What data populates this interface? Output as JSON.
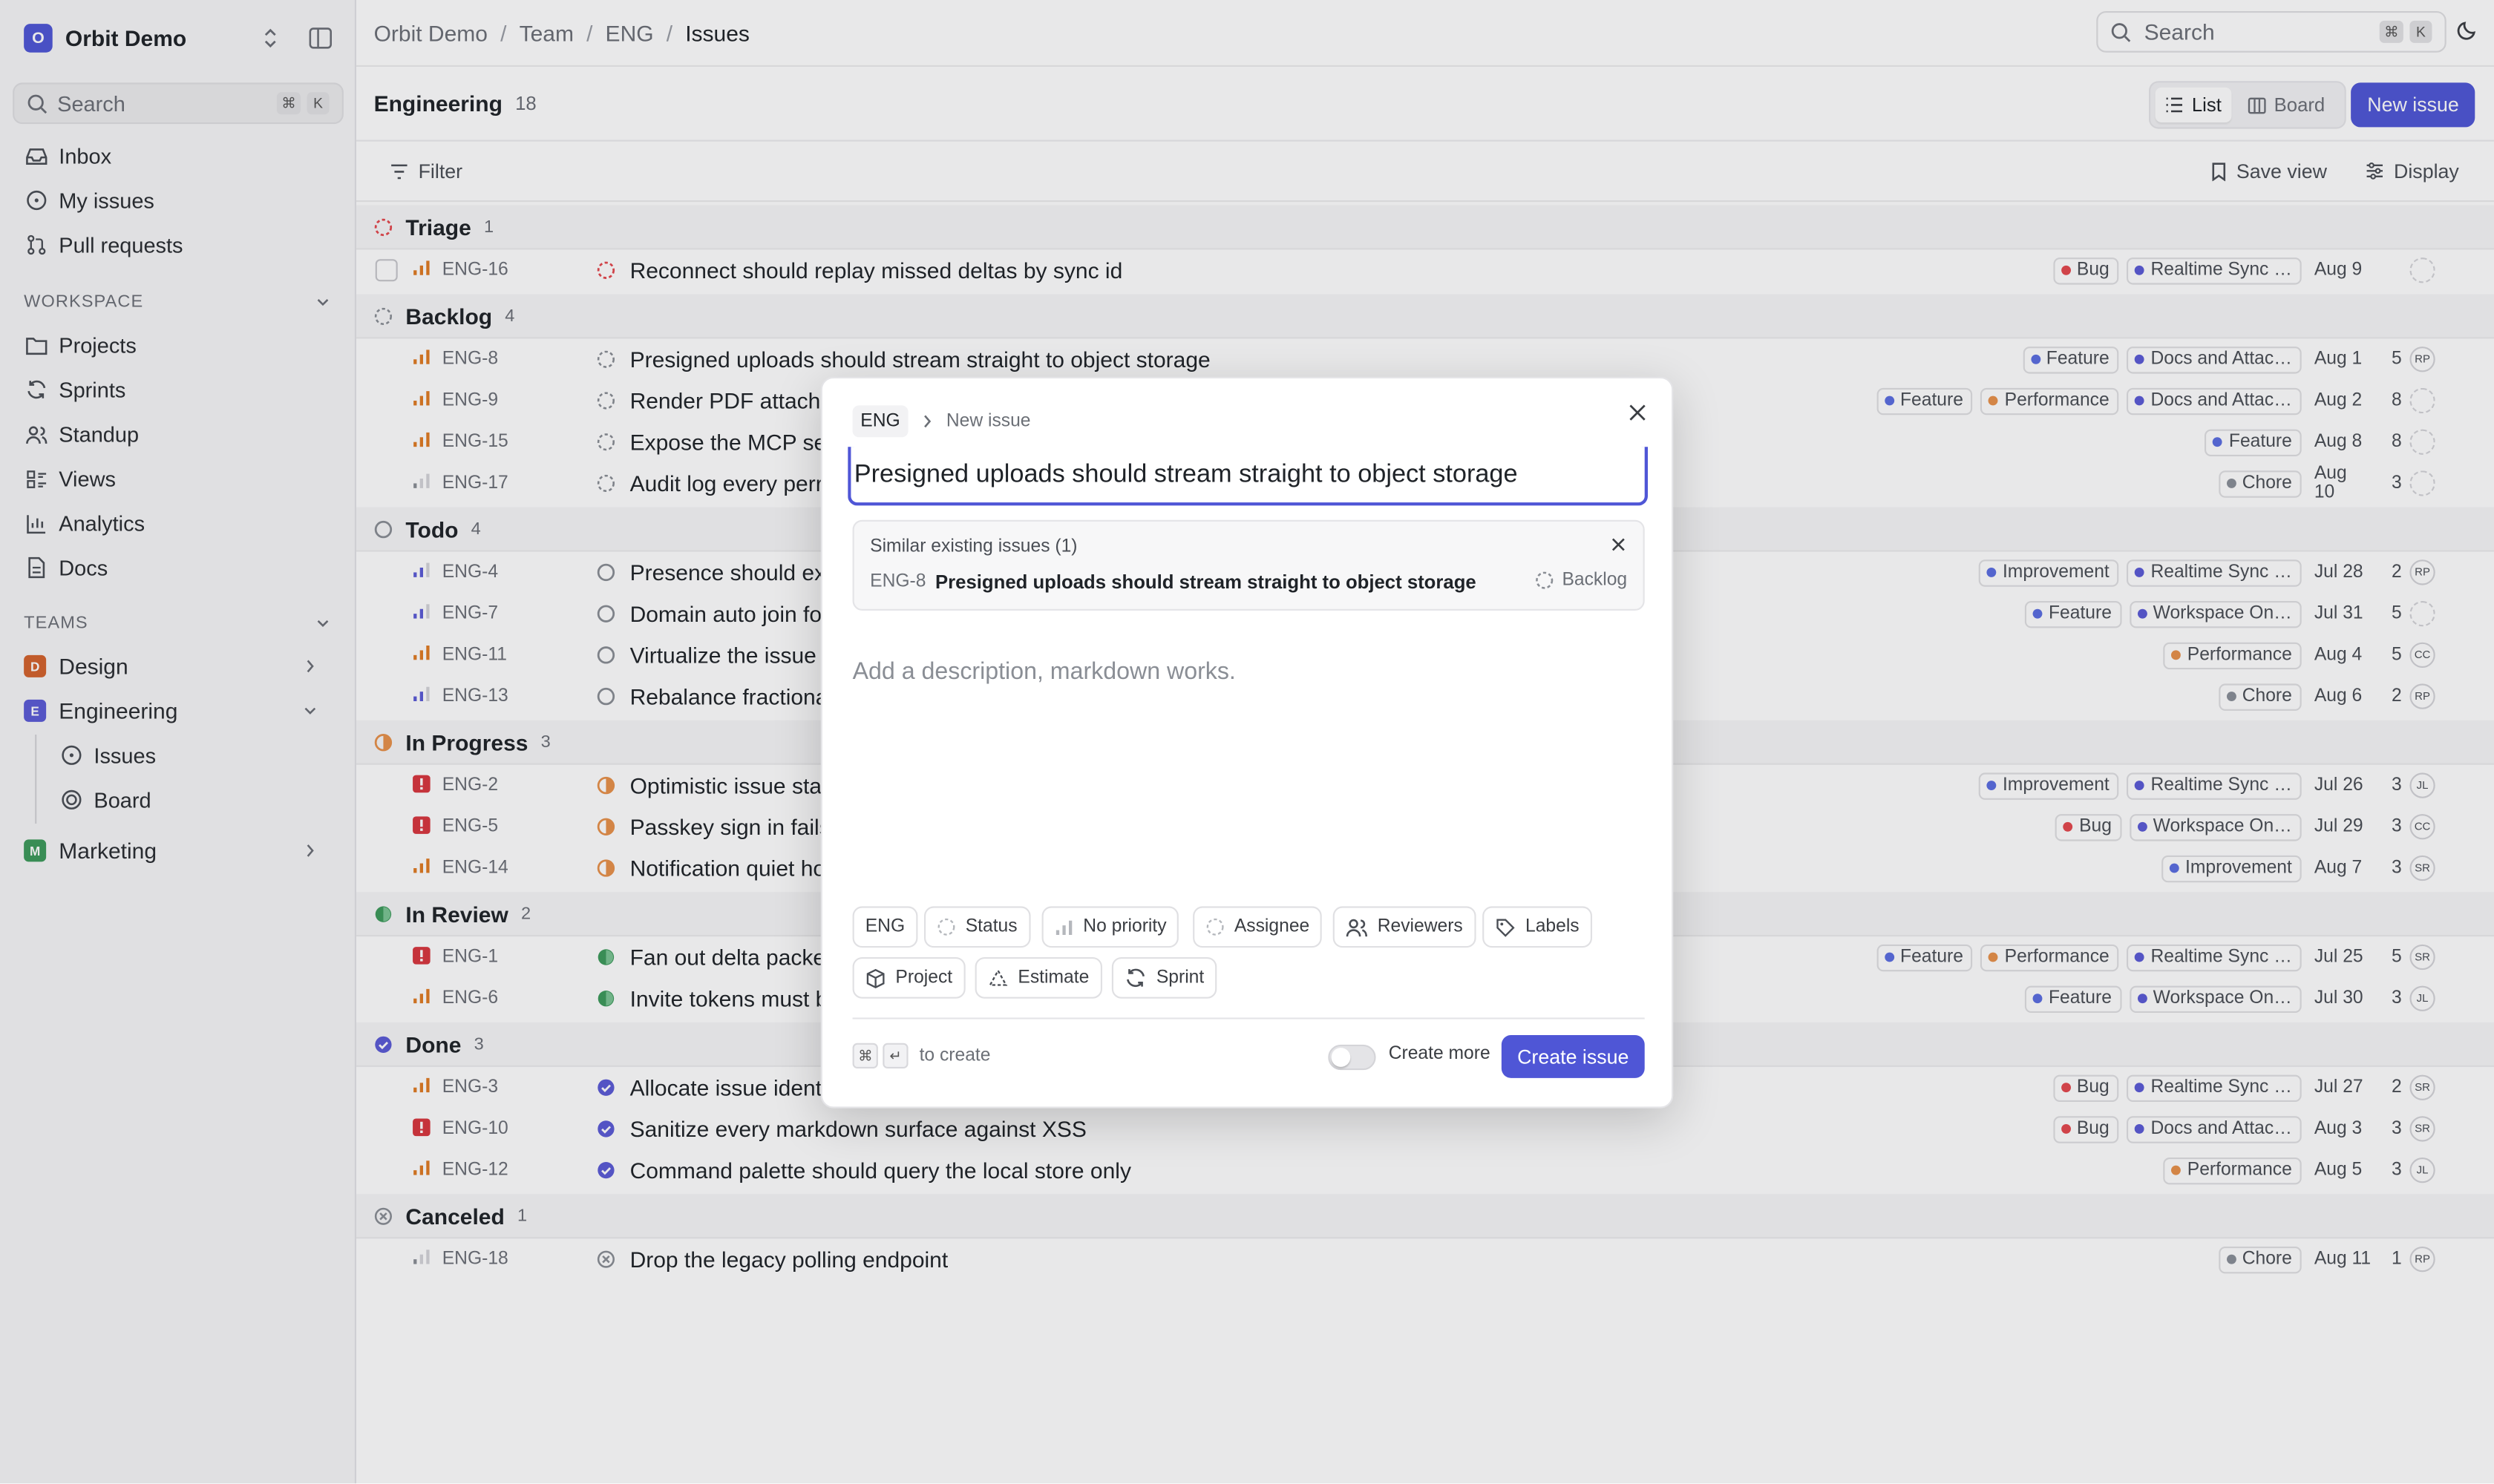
{
  "colors": {
    "accent": "#4f56d6",
    "bug": "#e5484d",
    "feature": "#5b6ee1",
    "performance": "#e8914a",
    "realtime": "#5b5bd6",
    "docs": "#5b5bd6",
    "workspace": "#5b5bd6",
    "improvement": "#5b6ee1",
    "chore": "#8a8f98"
  },
  "sidebar": {
    "workspace_initial": "O",
    "workspace_name": "Orbit Demo",
    "search_placeholder": "Search",
    "search_kbd": [
      "⌘",
      "K"
    ],
    "top_items": [
      {
        "label": "Inbox",
        "icon": "inbox-icon"
      },
      {
        "label": "My issues",
        "icon": "target-icon"
      },
      {
        "label": "Pull requests",
        "icon": "git-pull-request-icon"
      }
    ],
    "workspace_label": "WORKSPACE",
    "workspace_items": [
      {
        "label": "Projects",
        "icon": "folder-icon"
      },
      {
        "label": "Sprints",
        "icon": "refresh-icon"
      },
      {
        "label": "Standup",
        "icon": "people-icon"
      },
      {
        "label": "Views",
        "icon": "layers-icon"
      },
      {
        "label": "Analytics",
        "icon": "bar-chart-icon"
      },
      {
        "label": "Docs",
        "icon": "document-icon"
      }
    ],
    "teams_label": "TEAMS",
    "teams": [
      {
        "initial": "D",
        "label": "Design",
        "color": "#d4622c"
      },
      {
        "initial": "E",
        "label": "Engineering",
        "color": "#5b5bd6"
      },
      {
        "initial": "M",
        "label": "Marketing",
        "color": "#3d9a5b"
      }
    ],
    "team_sub_items": [
      {
        "label": "Issues",
        "icon": "target-icon"
      },
      {
        "label": "Board",
        "icon": "board-icon"
      }
    ]
  },
  "breadcrumb": [
    "Orbit Demo",
    "Team",
    "ENG",
    "Issues"
  ],
  "topbar": {
    "search_placeholder": "Search",
    "search_kbd": [
      "⌘",
      "K"
    ]
  },
  "header": {
    "title": "Engineering",
    "count": "18",
    "views": [
      "List",
      "Board"
    ],
    "new_issue": "New issue"
  },
  "filterbar": {
    "filter": "Filter",
    "save_view": "Save view",
    "display": "Display"
  },
  "groups": [
    {
      "name": "Triage",
      "count": "1",
      "status": "triage",
      "issues": [
        {
          "id": "ENG-16",
          "title": "Reconnect should replay missed deltas by sync id",
          "priority": "high",
          "labels": [
            {
              "text": "Bug",
              "color": "#e5484d"
            },
            {
              "text": "Realtime Sync …",
              "color": "#5b5bd6"
            }
          ],
          "date": "Aug 9",
          "estimate": "",
          "avatar": ""
        }
      ]
    },
    {
      "name": "Backlog",
      "count": "4",
      "status": "backlog",
      "issues": [
        {
          "id": "ENG-8",
          "title": "Presigned uploads should stream straight to object storage",
          "priority": "high",
          "labels": [
            {
              "text": "Feature",
              "color": "#5b6ee1"
            },
            {
              "text": "Docs and Attac…",
              "color": "#5b5bd6"
            }
          ],
          "date": "Aug 1",
          "estimate": "5",
          "avatar": "RP"
        },
        {
          "id": "ENG-9",
          "title": "Render PDF attachm",
          "priority": "high",
          "labels": [
            {
              "text": "Feature",
              "color": "#5b6ee1"
            },
            {
              "text": "Performance",
              "color": "#e8914a"
            },
            {
              "text": "Docs and Attac…",
              "color": "#5b5bd6"
            }
          ],
          "date": "Aug 2",
          "estimate": "8",
          "avatar": ""
        },
        {
          "id": "ENG-15",
          "title": "Expose the MCP se",
          "priority": "high",
          "labels": [
            {
              "text": "Feature",
              "color": "#5b6ee1"
            }
          ],
          "date": "Aug 8",
          "estimate": "8",
          "avatar": ""
        },
        {
          "id": "ENG-17",
          "title": "Audit log every perr",
          "priority": "low",
          "labels": [
            {
              "text": "Chore",
              "color": "#8a8f98"
            }
          ],
          "date": "Aug 10",
          "estimate": "3",
          "avatar": ""
        }
      ]
    },
    {
      "name": "Todo",
      "count": "4",
      "status": "todo",
      "issues": [
        {
          "id": "ENG-4",
          "title": "Presence should ex",
          "priority": "medium",
          "labels": [
            {
              "text": "Improvement",
              "color": "#5b6ee1"
            },
            {
              "text": "Realtime Sync …",
              "color": "#5b5bd6"
            }
          ],
          "date": "Jul 28",
          "estimate": "2",
          "avatar": "RP"
        },
        {
          "id": "ENG-7",
          "title": "Domain auto join fo",
          "priority": "medium",
          "labels": [
            {
              "text": "Feature",
              "color": "#5b6ee1"
            },
            {
              "text": "Workspace On…",
              "color": "#5b5bd6"
            }
          ],
          "date": "Jul 31",
          "estimate": "5",
          "avatar": ""
        },
        {
          "id": "ENG-11",
          "title": "Virtualize the issue",
          "priority": "high",
          "labels": [
            {
              "text": "Performance",
              "color": "#e8914a"
            }
          ],
          "date": "Aug 4",
          "estimate": "5",
          "avatar": "CC"
        },
        {
          "id": "ENG-13",
          "title": "Rebalance fractiona",
          "priority": "medium",
          "labels": [
            {
              "text": "Chore",
              "color": "#8a8f98"
            }
          ],
          "date": "Aug 6",
          "estimate": "2",
          "avatar": "RP"
        }
      ]
    },
    {
      "name": "In Progress",
      "count": "3",
      "status": "progress",
      "issues": [
        {
          "id": "ENG-2",
          "title": "Optimistic issue sta",
          "priority": "urgent",
          "labels": [
            {
              "text": "Improvement",
              "color": "#5b6ee1"
            },
            {
              "text": "Realtime Sync …",
              "color": "#5b5bd6"
            }
          ],
          "date": "Jul 26",
          "estimate": "3",
          "avatar": "JL"
        },
        {
          "id": "ENG-5",
          "title": "Passkey sign in fails",
          "priority": "urgent",
          "labels": [
            {
              "text": "Bug",
              "color": "#e5484d"
            },
            {
              "text": "Workspace On…",
              "color": "#5b5bd6"
            }
          ],
          "date": "Jul 29",
          "estimate": "3",
          "avatar": "CC"
        },
        {
          "id": "ENG-14",
          "title": "Notification quiet ho",
          "priority": "high",
          "labels": [
            {
              "text": "Improvement",
              "color": "#5b6ee1"
            }
          ],
          "date": "Aug 7",
          "estimate": "3",
          "avatar": "SR"
        }
      ]
    },
    {
      "name": "In Review",
      "count": "2",
      "status": "review",
      "issues": [
        {
          "id": "ENG-1",
          "title": "Fan out delta packe",
          "priority": "urgent",
          "labels": [
            {
              "text": "Feature",
              "color": "#5b6ee1"
            },
            {
              "text": "Performance",
              "color": "#e8914a"
            },
            {
              "text": "Realtime Sync …",
              "color": "#5b5bd6"
            }
          ],
          "date": "Jul 25",
          "estimate": "5",
          "avatar": "SR"
        },
        {
          "id": "ENG-6",
          "title": "Invite tokens must b",
          "priority": "high",
          "labels": [
            {
              "text": "Feature",
              "color": "#5b6ee1"
            },
            {
              "text": "Workspace On…",
              "color": "#5b5bd6"
            }
          ],
          "date": "Jul 30",
          "estimate": "3",
          "avatar": "JL"
        }
      ]
    },
    {
      "name": "Done",
      "count": "3",
      "status": "done",
      "issues": [
        {
          "id": "ENG-3",
          "title": "Allocate issue ident",
          "priority": "high",
          "labels": [
            {
              "text": "Bug",
              "color": "#e5484d"
            },
            {
              "text": "Realtime Sync …",
              "color": "#5b5bd6"
            }
          ],
          "date": "Jul 27",
          "estimate": "2",
          "avatar": "SR"
        },
        {
          "id": "ENG-10",
          "title": "Sanitize every markdown surface against XSS",
          "priority": "urgent",
          "labels": [
            {
              "text": "Bug",
              "color": "#e5484d"
            },
            {
              "text": "Docs and Attac…",
              "color": "#5b5bd6"
            }
          ],
          "date": "Aug 3",
          "estimate": "3",
          "avatar": "SR"
        },
        {
          "id": "ENG-12",
          "title": "Command palette should query the local store only",
          "priority": "high",
          "labels": [
            {
              "text": "Performance",
              "color": "#e8914a"
            }
          ],
          "date": "Aug 5",
          "estimate": "3",
          "avatar": "JL"
        }
      ]
    },
    {
      "name": "Canceled",
      "count": "1",
      "status": "canceled",
      "issues": [
        {
          "id": "ENG-18",
          "title": "Drop the legacy polling endpoint",
          "priority": "low",
          "labels": [
            {
              "text": "Chore",
              "color": "#8a8f98"
            }
          ],
          "date": "Aug 11",
          "estimate": "1",
          "avatar": "RP"
        }
      ]
    }
  ],
  "modal": {
    "team": "ENG",
    "crumb": "New issue",
    "title_value": "Presigned uploads should stream straight to object storage",
    "similar_heading": "Similar existing issues (1)",
    "similar_id": "ENG-8",
    "similar_title": "Presigned uploads should stream straight to object storage",
    "similar_status": "Backlog",
    "description_placeholder": "Add a description, markdown works.",
    "chips_row1": [
      {
        "label": "ENG",
        "icon": ""
      },
      {
        "label": "Status",
        "icon": "status-circle-icon"
      },
      {
        "label": "No priority",
        "icon": "priority-bars-icon"
      },
      {
        "label": "Assignee",
        "icon": "assignee-circle-icon"
      },
      {
        "label": "Reviewers",
        "icon": "people-icon"
      },
      {
        "label": "Labels",
        "icon": "tag-icon"
      }
    ],
    "chips_row2": [
      {
        "label": "Project",
        "icon": "cube-icon"
      },
      {
        "label": "Estimate",
        "icon": "triangle-icon"
      },
      {
        "label": "Sprint",
        "icon": "refresh-icon"
      }
    ],
    "hint_keys": [
      "⌘",
      "↵"
    ],
    "hint_text": "to create",
    "create_more": "Create more",
    "create_button": "Create issue"
  }
}
